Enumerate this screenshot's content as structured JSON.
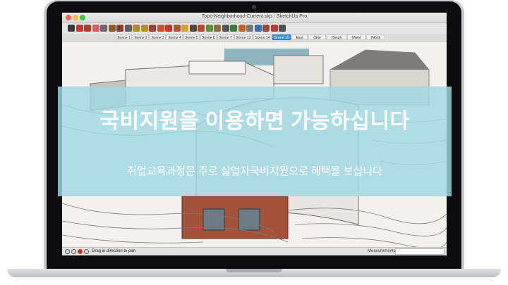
{
  "app": {
    "window_title": "Topo-Neighborhood-Current.skp - SketchUp Pro",
    "traffic_colors": [
      "#fc605c",
      "#fdbc40",
      "#34c84a"
    ]
  },
  "toolbar": {
    "tools": [
      {
        "name": "select-tool-icon",
        "color": "#3b3b3b"
      },
      {
        "name": "pencil-tool-icon",
        "color": "#c0392b"
      },
      {
        "name": "line-tool-icon",
        "color": "#b03a2e"
      },
      {
        "name": "eraser-tool-icon",
        "color": "#d35d6e"
      },
      {
        "name": "rectangle-tool-icon",
        "color": "#6b6b6b"
      },
      {
        "name": "circle-tool-icon",
        "color": "#8e5a2c"
      },
      {
        "name": "arc-tool-icon",
        "color": "#8b3a2b"
      },
      {
        "name": "polygon-tool-icon",
        "color": "#5f5f5f"
      },
      {
        "name": "paint-bucket-icon",
        "color": "#b08a2d"
      },
      {
        "name": "push-pull-icon",
        "color": "#c28b2f"
      },
      {
        "name": "move-tool-icon",
        "color": "#a33d2d"
      },
      {
        "name": "rotate-tool-icon",
        "color": "#d14d2d"
      },
      {
        "name": "scale-tool-icon",
        "color": "#c0392b"
      },
      {
        "name": "offset-tool-icon",
        "color": "#a55a2a"
      },
      {
        "name": "tape-measure-icon",
        "color": "#d4a437"
      },
      {
        "name": "text-tool-icon",
        "color": "#4a4a4a"
      },
      {
        "name": "axes-tool-icon",
        "color": "#b7472a"
      },
      {
        "name": "orbit-tool-icon",
        "color": "#5e8f3a"
      },
      {
        "name": "pan-tool-icon",
        "color": "#8a6a43"
      },
      {
        "name": "zoom-tool-icon",
        "color": "#555555"
      },
      {
        "name": "zoom-extents-icon",
        "color": "#3c7a3c"
      },
      {
        "name": "section-plane-icon",
        "color": "#c7612b"
      },
      {
        "name": "walk-tool-icon",
        "color": "#7a7a7a"
      },
      {
        "name": "look-around-icon",
        "color": "#3b6fb0"
      },
      {
        "name": "warehouse-icon",
        "color": "#9b4a3a"
      },
      {
        "name": "extension-icon",
        "color": "#b43c3c"
      },
      {
        "name": "layout-icon",
        "color": "#4f4f4f"
      }
    ]
  },
  "scenes": {
    "tabs": [
      "Scene 1",
      "Scene 2",
      "Scene 3",
      "Scene 4",
      "Scene 5",
      "Scene 6",
      "Scene 7",
      "Scene 13",
      "Scene 14",
      "Scene 15",
      "East Elev",
      "(Site Plan)",
      "(South Elev)",
      "(West Elev)",
      "(North Elev)"
    ],
    "active_index": 9
  },
  "status": {
    "hint": "Drag in direction to pan",
    "measurements_label": "Measurements"
  },
  "overlay": {
    "headline": "국비지원을 이용하면 가능하십니다",
    "subline": "취업교육과정은 주로 실업자국비지원으로 혜택을 보십니다",
    "color": "#a0d8e4"
  }
}
